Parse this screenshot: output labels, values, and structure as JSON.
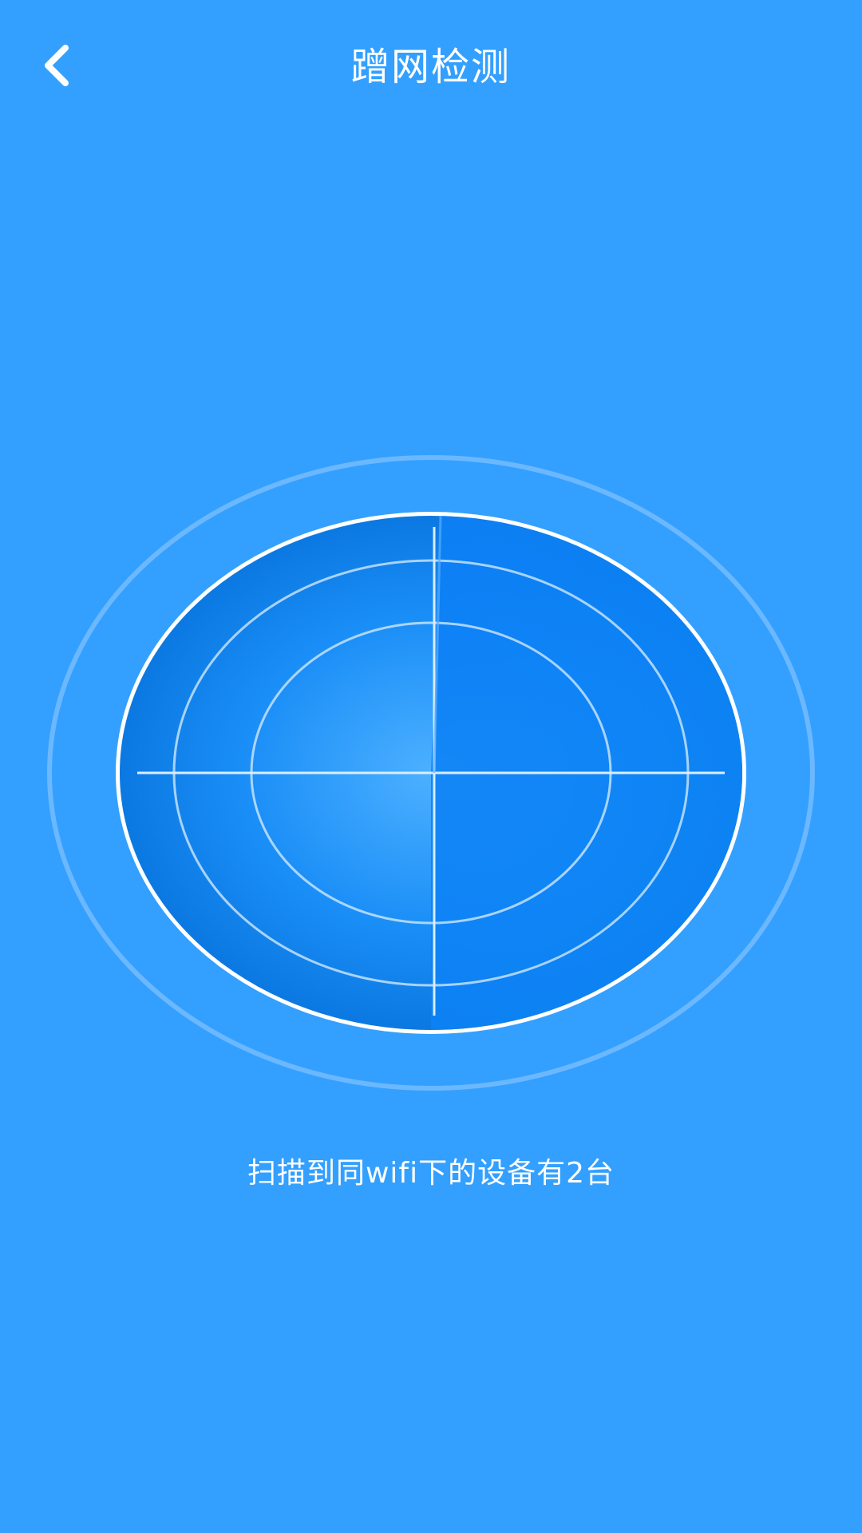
{
  "header": {
    "title": "蹭网检测",
    "back_icon": "chevron-left-icon"
  },
  "radar": {
    "icon": "radar-scan-icon",
    "colors": {
      "background": "#33a0ff",
      "disk": "#0b7fe8",
      "sweep": "#0a80f5",
      "rings": "#b9dcff"
    }
  },
  "status": {
    "message": "扫描到同wifi下的设备有2台"
  }
}
